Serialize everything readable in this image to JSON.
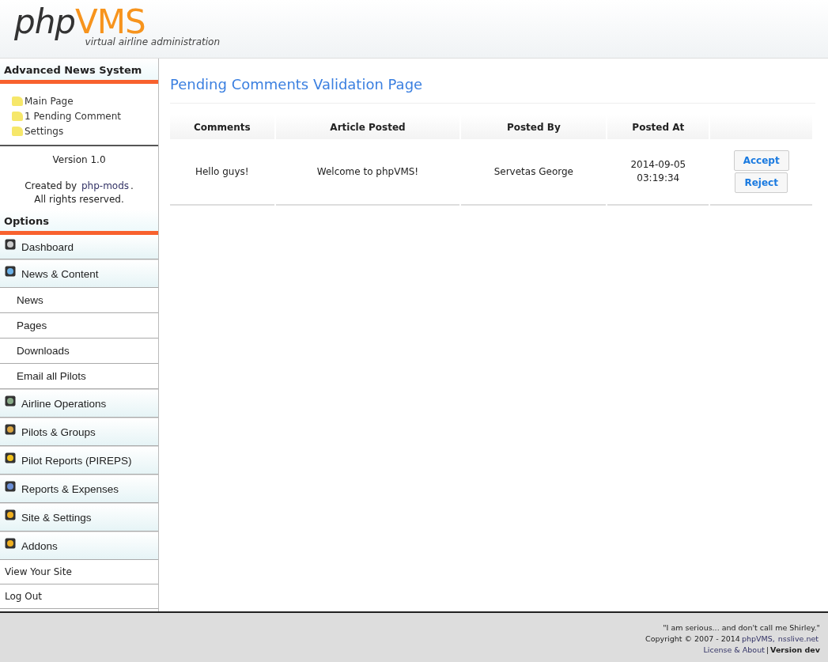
{
  "header": {
    "logo_dark": "php",
    "logo_accent": "VMS",
    "tagline": "virtual airline administration"
  },
  "plugin": {
    "title": "Advanced News System",
    "links": [
      "Main Page",
      "1 Pending Comment",
      "Settings"
    ],
    "version": "Version 1.0",
    "credit_prefix": "Created by ",
    "credit_link": "php-mods",
    "credit_suffix": ".",
    "rights": "All rights reserved."
  },
  "options": {
    "title": "Options",
    "items": [
      {
        "kind": "section",
        "label": "Dashboard"
      },
      {
        "kind": "section",
        "label": "News & Content"
      },
      {
        "kind": "sub",
        "label": "News"
      },
      {
        "kind": "sub",
        "label": "Pages"
      },
      {
        "kind": "sub",
        "label": "Downloads"
      },
      {
        "kind": "sub",
        "label": "Email all Pilots"
      },
      {
        "kind": "section",
        "label": "Airline Operations"
      },
      {
        "kind": "section",
        "label": "Pilots & Groups"
      },
      {
        "kind": "section",
        "label": "Pilot Reports (PIREPS)"
      },
      {
        "kind": "section",
        "label": "Reports & Expenses"
      },
      {
        "kind": "section",
        "label": "Site & Settings"
      },
      {
        "kind": "section",
        "label": "Addons"
      },
      {
        "kind": "link",
        "label": "View Your Site"
      },
      {
        "kind": "link",
        "label": "Log Out"
      }
    ]
  },
  "page": {
    "title": "Pending Comments Validation Page"
  },
  "table": {
    "columns": [
      "Comments",
      "Article Posted",
      "Posted By",
      "Posted At"
    ],
    "rows": [
      {
        "comment": "Hello guys!",
        "article": "Welcome to phpVMS!",
        "posted_by": "Servetas George",
        "date": "2014-09-05",
        "time": "03:19:34",
        "actions": [
          "Accept",
          "Reject"
        ]
      }
    ]
  },
  "footer": {
    "quote": "\"I am serious... and don't call me Shirley.\"",
    "copyright": "Copyright © 2007 - 2014",
    "link_1": "phpVMS,",
    "link_2": "nsslive.net",
    "license": "License & About",
    "separator": "|",
    "version": "Version dev"
  }
}
